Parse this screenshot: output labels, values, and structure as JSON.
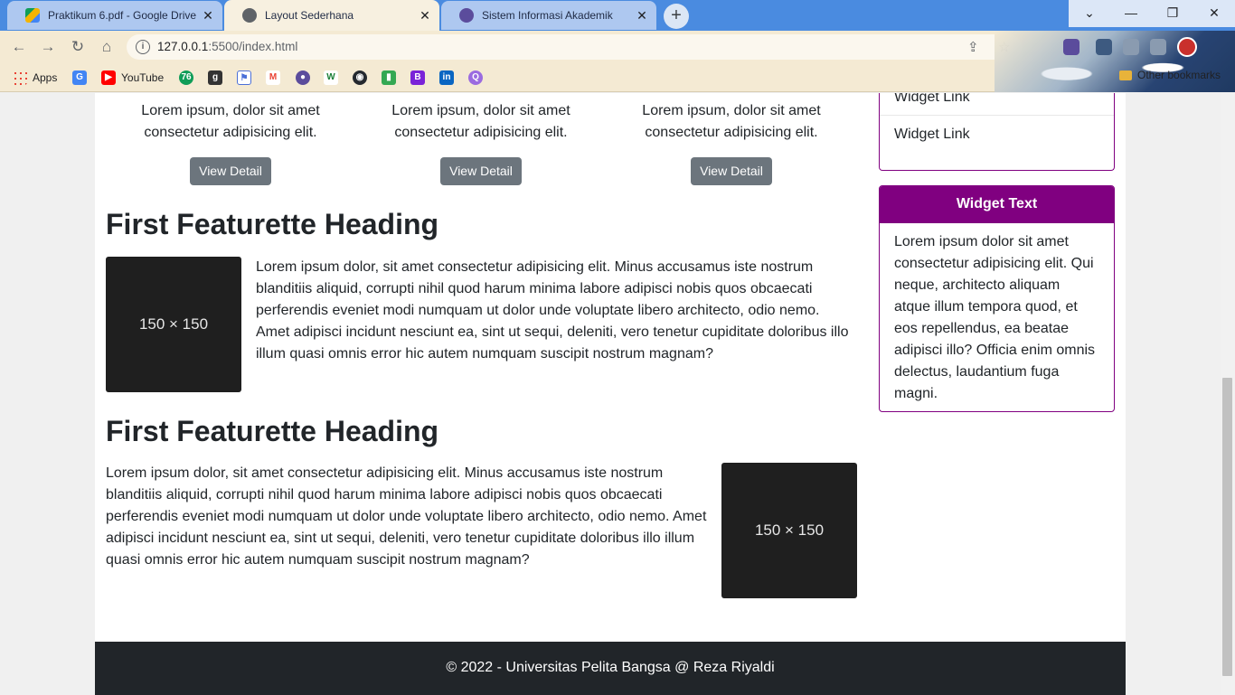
{
  "browser": {
    "tabs": [
      {
        "title": "Praktikum 6.pdf - Google Drive",
        "icon": "google-drive-icon"
      },
      {
        "title": "Layout Sederhana",
        "icon": "globe-icon"
      },
      {
        "title": "Sistem Informasi Akademik",
        "icon": "university-icon"
      }
    ],
    "address": {
      "host": "127.0.0.1",
      "rest": ":5500/index.html"
    },
    "bookmarks": [
      {
        "label": "Apps",
        "icon": "apps-grid-icon"
      },
      {
        "label": "",
        "icon": "google-translate-icon"
      },
      {
        "label": "YouTube",
        "icon": "youtube-icon"
      }
    ],
    "other_bookmarks": "Other bookmarks"
  },
  "cards": [
    {
      "text": "Lorem ipsum, dolor sit amet consectetur adipisicing elit.",
      "button": "View Detail"
    },
    {
      "text": "Lorem ipsum, dolor sit amet consectetur adipisicing elit.",
      "button": "View Detail"
    },
    {
      "text": "Lorem ipsum, dolor sit amet consectetur adipisicing elit.",
      "button": "View Detail"
    }
  ],
  "featurettes": [
    {
      "heading": "First Featurette Heading",
      "image_label": "150 × 150",
      "text": "Lorem ipsum dolor, sit amet consectetur adipisicing elit. Minus accusamus iste nostrum blanditiis aliquid, corrupti nihil quod harum minima labore adipisci nobis quos obcaecati perferendis eveniet modi numquam ut dolor unde voluptate libero architecto, odio nemo. Amet adipisci incidunt nesciunt ea, sint ut sequi, deleniti, vero tenetur cupiditate doloribus illo illum quasi omnis error hic autem numquam suscipit nostrum magnam?"
    },
    {
      "heading": "First Featurette Heading",
      "image_label": "150 × 150",
      "text": "Lorem ipsum dolor, sit amet consectetur adipisicing elit. Minus accusamus iste nostrum blanditiis aliquid, corrupti nihil quod harum minima labore adipisci nobis quos obcaecati perferendis eveniet modi numquam ut dolor unde voluptate libero architecto, odio nemo. Amet adipisci incidunt nesciunt ea, sint ut sequi, deleniti, vero tenetur cupiditate doloribus illo illum quasi omnis error hic autem numquam suscipit nostrum magnam?"
    }
  ],
  "sidebar": {
    "links": [
      "Widget Link",
      "Widget Link"
    ],
    "widget_text": {
      "title": "Widget Text",
      "body": "Lorem ipsum dolor sit amet consectetur adipisicing elit. Qui neque, architecto aliquam atque illum tempora quod, et eos repellendus, ea beatae adipisci illo? Officia enim omnis delectus, laudantium fuga magni."
    }
  },
  "footer": {
    "text": "© 2022 - Universitas Pelita Bangsa @ Reza Riyaldi"
  },
  "colors": {
    "widget_accent": "#800080",
    "button_secondary": "#6c757d",
    "footer_bg": "#212529",
    "image_placeholder": "#1f1f1f"
  }
}
